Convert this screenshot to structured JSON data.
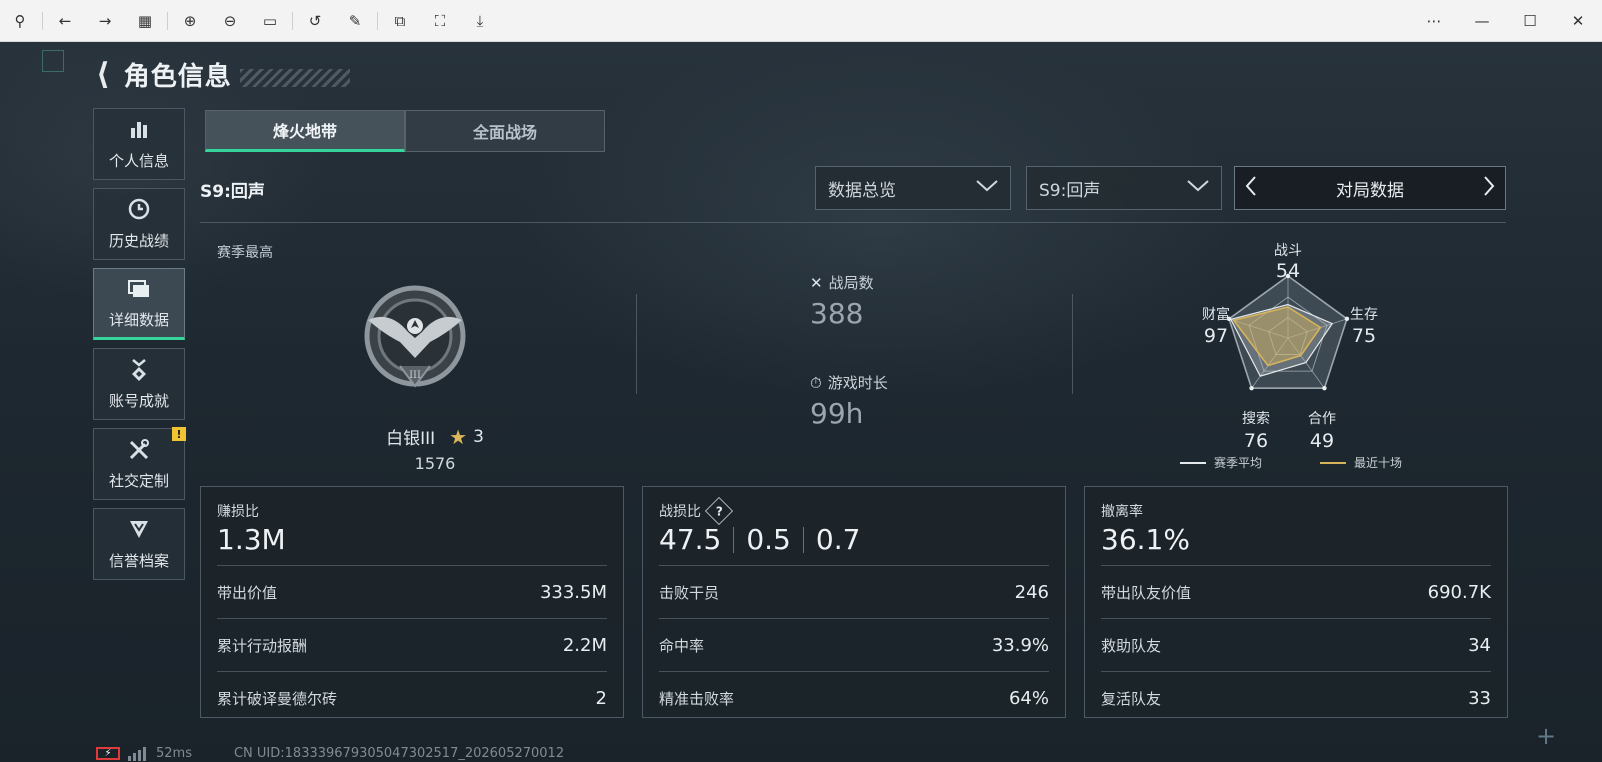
{
  "titlebar": {
    "icons": [
      "pin-icon",
      "back-icon",
      "forward-icon",
      "grid-icon",
      "zoom-in-icon",
      "zoom-out-icon",
      "fit-icon",
      "rotate-icon",
      "edit-icon",
      "screenshot-icon",
      "capture-icon",
      "save-icon",
      "more-icon",
      "minimize-icon",
      "maximize-icon",
      "close-icon"
    ]
  },
  "header": {
    "title": "角色信息"
  },
  "sidebar": {
    "items": [
      {
        "label": "个人信息",
        "icon": "bar-chart-icon"
      },
      {
        "label": "历史战绩",
        "icon": "clock-icon"
      },
      {
        "label": "详细数据",
        "icon": "folders-icon"
      },
      {
        "label": "账号成就",
        "icon": "medal-icon"
      },
      {
        "label": "社交定制",
        "icon": "tools-icon",
        "badge": "!"
      },
      {
        "label": "信誉档案",
        "icon": "shield-icon"
      }
    ],
    "active_index": 2
  },
  "tabs": [
    {
      "label": "烽火地带"
    },
    {
      "label": "全面战场"
    }
  ],
  "season": {
    "label": "S9:回声"
  },
  "filters": {
    "view_select": "数据总览",
    "season_select": "S9:回声",
    "pager_label": "对局数据"
  },
  "overview": {
    "season_high_label": "赛季最高",
    "rank_name": "白银III",
    "rank_stars": "3",
    "rank_score": "1576",
    "matches_label": "战局数",
    "matches_value": "388",
    "playtime_label": "游戏时长",
    "playtime_value": "99h"
  },
  "radar": {
    "axes": [
      {
        "label": "战斗",
        "value": "54"
      },
      {
        "label": "生存",
        "value": "75"
      },
      {
        "label": "合作",
        "value": "49"
      },
      {
        "label": "搜索",
        "value": "76"
      },
      {
        "label": "财富",
        "value": "97"
      }
    ],
    "season_avg_values": [
      54,
      75,
      49,
      76,
      97
    ],
    "recent_values": [
      50,
      55,
      35,
      55,
      92
    ],
    "legend_season_avg": "赛季平均",
    "legend_recent": "最近十场",
    "colors": {
      "season_avg": "#e6e9ec",
      "recent": "#d6b45a"
    }
  },
  "cards": [
    {
      "title": "赚损比",
      "big": [
        "1.3M"
      ],
      "rows": [
        {
          "k": "带出价值",
          "v": "333.5M"
        },
        {
          "k": "累计行动报酬",
          "v": "2.2M"
        },
        {
          "k": "累计破译曼德尔砖",
          "v": "2"
        }
      ]
    },
    {
      "title": "战损比",
      "help": "?",
      "big": [
        "47.5",
        "0.5",
        "0.7"
      ],
      "rows": [
        {
          "k": "击败干员",
          "v": "246"
        },
        {
          "k": "命中率",
          "v": "33.9%"
        },
        {
          "k": "精准击败率",
          "v": "64%"
        }
      ]
    },
    {
      "title": "撤离率",
      "big": [
        "36.1%"
      ],
      "rows": [
        {
          "k": "带出队友价值",
          "v": "690.7K"
        },
        {
          "k": "救助队友",
          "v": "34"
        },
        {
          "k": "复活队友",
          "v": "33"
        }
      ]
    }
  ],
  "status": {
    "ping": "52ms",
    "uid": "CN UID:18333967930504730251​7_202605270012"
  },
  "colors": {
    "accent": "#35d49a",
    "badge": "#f1c232",
    "battery_low": "#e03a3a"
  }
}
